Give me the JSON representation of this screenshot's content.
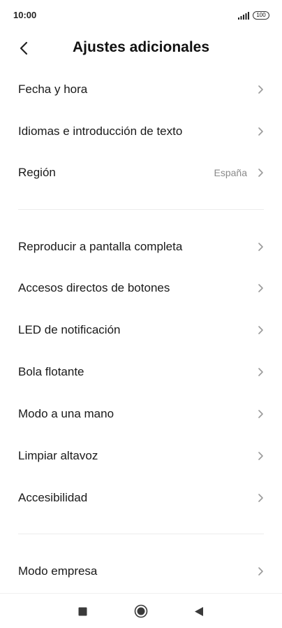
{
  "status_bar": {
    "time": "10:00",
    "battery": "100"
  },
  "header": {
    "title": "Ajustes adicionales",
    "back_icon": "chevron-left-icon"
  },
  "sections": [
    {
      "items": [
        {
          "label": "Fecha y hora",
          "value": ""
        },
        {
          "label": "Idiomas e introducción de texto",
          "value": ""
        },
        {
          "label": "Región",
          "value": "España"
        }
      ]
    },
    {
      "items": [
        {
          "label": "Reproducir a pantalla completa",
          "value": ""
        },
        {
          "label": "Accesos directos de botones",
          "value": ""
        },
        {
          "label": "LED de notificación",
          "value": ""
        },
        {
          "label": "Bola flotante",
          "value": ""
        },
        {
          "label": "Modo a una mano",
          "value": ""
        },
        {
          "label": "Limpiar altavoz",
          "value": ""
        },
        {
          "label": "Accesibilidad",
          "value": ""
        }
      ]
    },
    {
      "items": [
        {
          "label": "Modo empresa",
          "value": ""
        }
      ]
    }
  ],
  "nav_bar": {
    "icons": [
      "recents-square-icon",
      "home-circle-icon",
      "back-triangle-icon"
    ]
  }
}
